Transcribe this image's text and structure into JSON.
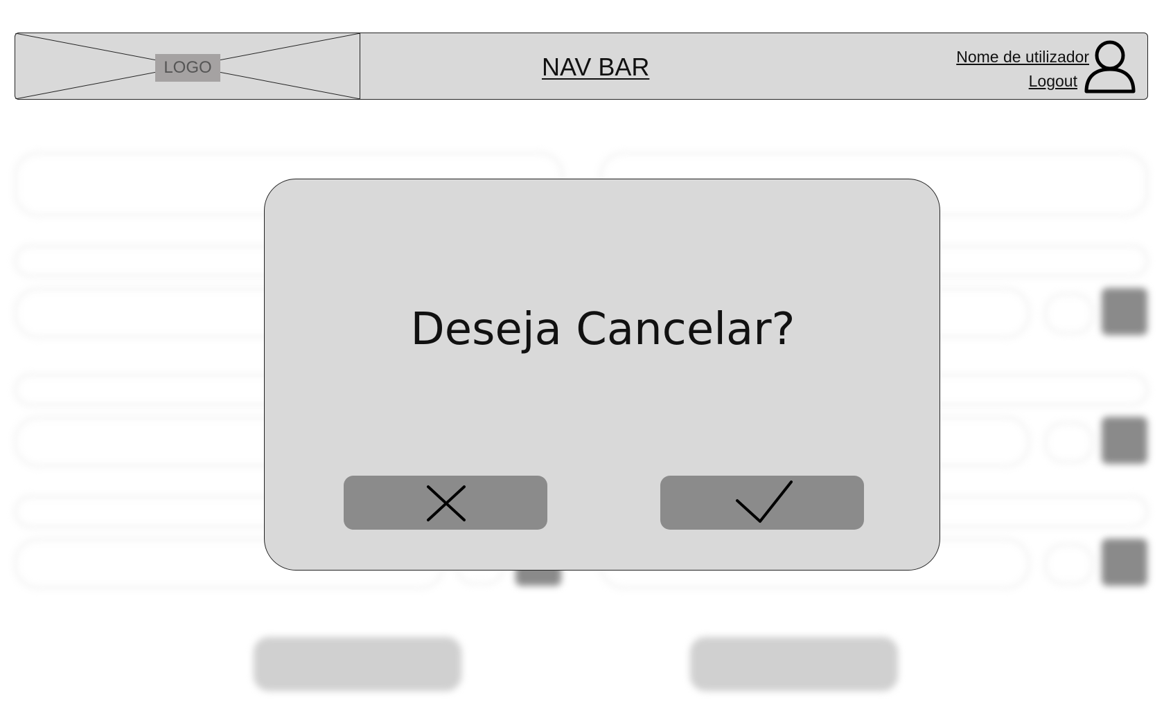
{
  "navbar": {
    "logo_text": "LOGO",
    "title": "NAV BAR",
    "user_name": "Nome de utilizador",
    "logout": "Logout",
    "user_icon": "user-icon"
  },
  "modal": {
    "question": "Deseja Cancelar?",
    "cancel_icon": "close-icon",
    "confirm_icon": "check-icon"
  },
  "colors": {
    "navbar_bg": "#d9d9d9",
    "modal_bg": "#d9d9d9",
    "modal_button_bg": "#8b8b8b",
    "logo_label_bg": "#a5a2a2"
  }
}
